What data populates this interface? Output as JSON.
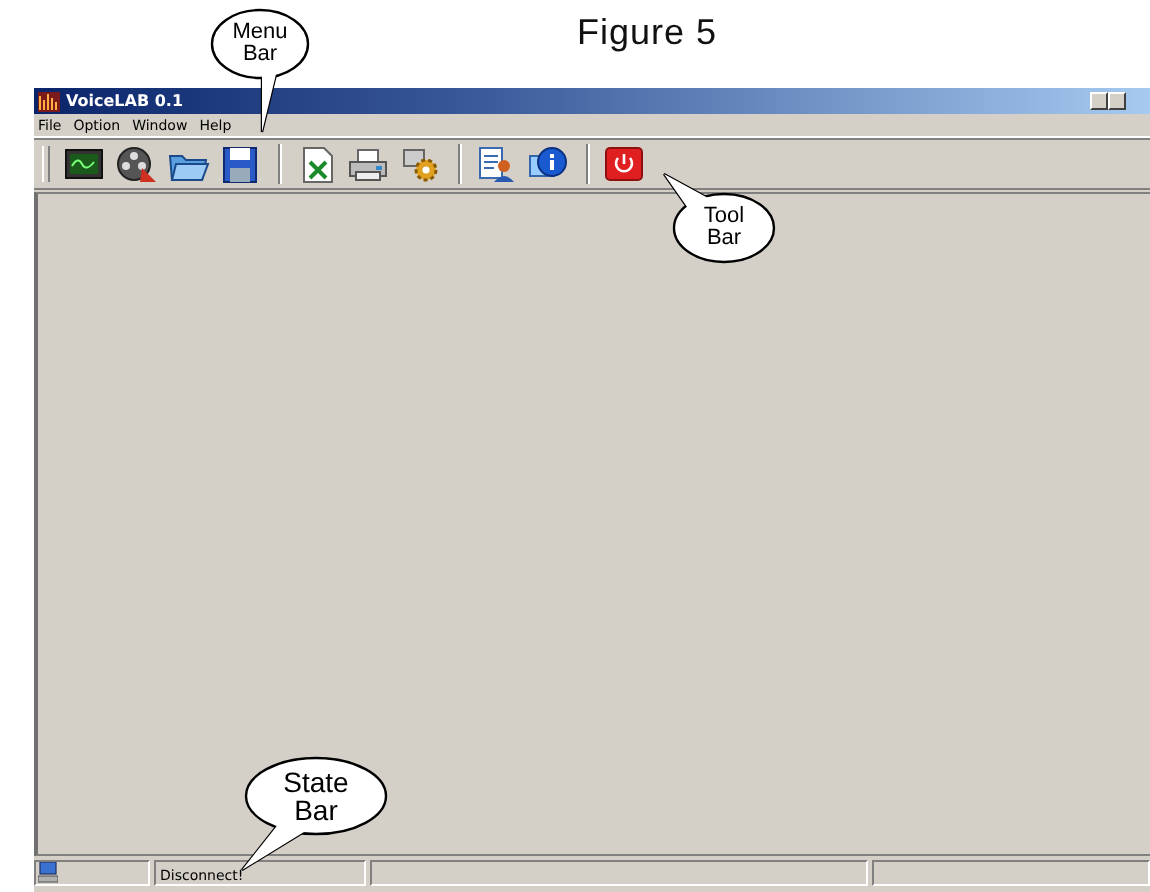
{
  "figure_title": "Figure 5",
  "window": {
    "title": "VoiceLAB 0.1"
  },
  "menu": [
    {
      "label": "File"
    },
    {
      "label": "Option"
    },
    {
      "label": "Window"
    },
    {
      "label": "Help"
    }
  ],
  "status_bar": {
    "text": "Disconnect!"
  },
  "callouts": [
    {
      "kind": "menu",
      "text": "Menu Bar"
    },
    {
      "kind": "tool",
      "text": "Tool Bar"
    },
    {
      "kind": "state",
      "text": "State Bar"
    }
  ]
}
